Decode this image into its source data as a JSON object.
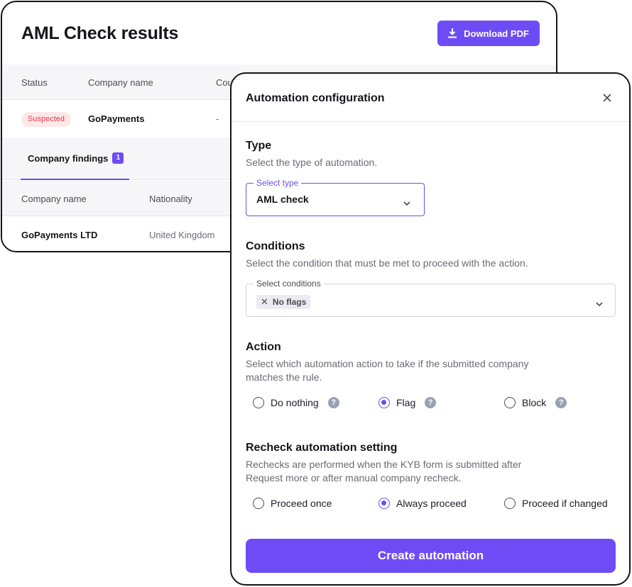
{
  "colors": {
    "accent": "#6e4cf5",
    "suspected_bg": "#fde8e8",
    "suspected_text": "#e0404a",
    "help_icon": "#9aa0b3"
  },
  "results": {
    "title": "AML Check results",
    "download_label": "Download PDF",
    "table": {
      "headers": [
        "Status",
        "Company name",
        "Cou"
      ],
      "row": {
        "status": "Suspected",
        "company": "GoPayments",
        "country": "-"
      }
    },
    "findings_tab": {
      "label": "Company findings",
      "count": "1"
    },
    "findings_table": {
      "headers": [
        "Company name",
        "Nationality"
      ],
      "row": {
        "company": "GoPayments LTD",
        "nationality": "United Kingdom"
      }
    }
  },
  "modal": {
    "title": "Automation configuration",
    "type": {
      "title": "Type",
      "description": "Select the type of automation.",
      "select_label": "Select type",
      "selected": "AML check"
    },
    "conditions": {
      "title": "Conditions",
      "description": "Select the condition that must be met to proceed with the action.",
      "select_label": "Select conditions",
      "chips": [
        "No flags"
      ]
    },
    "action": {
      "title": "Action",
      "description": "Select which automation action to take if the submitted company matches the rule.",
      "options": [
        {
          "label": "Do nothing",
          "selected": false
        },
        {
          "label": "Flag",
          "selected": true
        },
        {
          "label": "Block",
          "selected": false
        }
      ]
    },
    "recheck": {
      "title": "Recheck automation setting",
      "description": "Rechecks are performed when the KYB form is submitted after Request more or after manual company recheck.",
      "options": [
        {
          "label": "Proceed once",
          "selected": false
        },
        {
          "label": "Always proceed",
          "selected": true
        },
        {
          "label": "Proceed if changed",
          "selected": false
        }
      ]
    },
    "submit_label": "Create automation"
  }
}
